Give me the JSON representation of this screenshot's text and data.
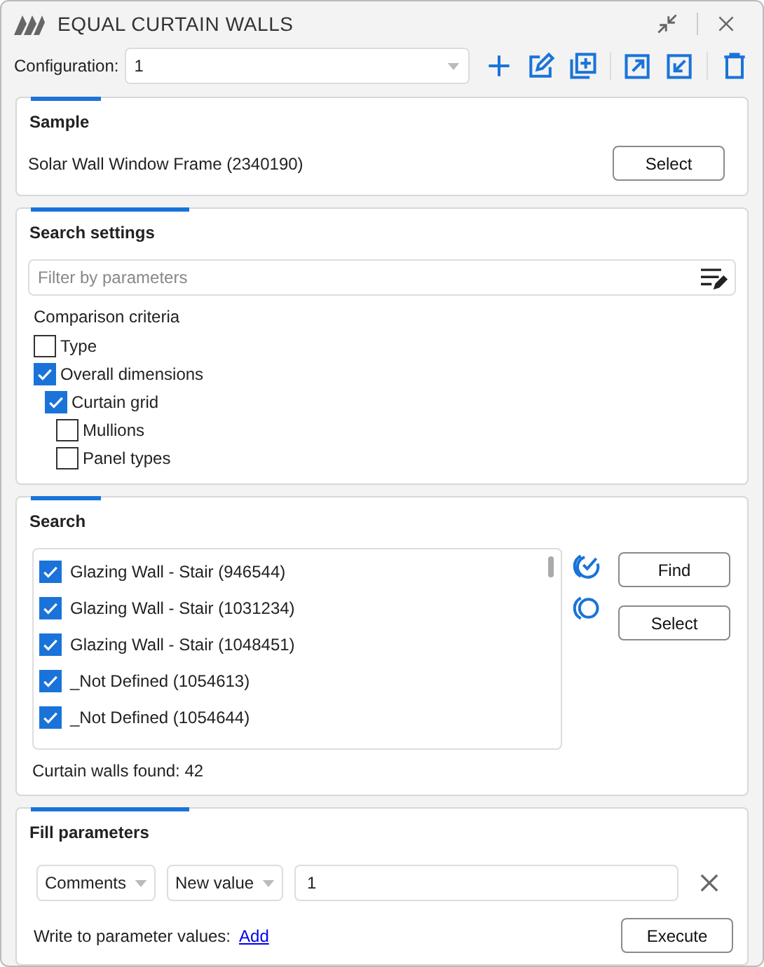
{
  "window": {
    "title": "EQUAL CURTAIN WALLS"
  },
  "configuration": {
    "label": "Configuration:",
    "value": "1"
  },
  "sample": {
    "title": "Sample",
    "element": "Solar Wall Window Frame (2340190)",
    "button": "Select"
  },
  "search_settings": {
    "title": "Search settings",
    "filter": {
      "placeholder": "Filter by parameters"
    },
    "criteria_label": "Comparison criteria",
    "criteria": [
      {
        "label": "Type",
        "checked": false
      },
      {
        "label": "Overall dimensions",
        "checked": true,
        "children": [
          {
            "label": "Curtain grid",
            "checked": true,
            "children": [
              {
                "label": "Mullions",
                "checked": false
              },
              {
                "label": "Panel types",
                "checked": false
              }
            ]
          }
        ]
      }
    ]
  },
  "search": {
    "title": "Search",
    "results": [
      {
        "label": "Glazing Wall - Stair (946544)",
        "checked": true
      },
      {
        "label": "Glazing Wall - Stair (1031234)",
        "checked": true
      },
      {
        "label": "Glazing Wall - Stair (1048451)",
        "checked": true
      },
      {
        "label": "_Not Defined (1054613)",
        "checked": true
      },
      {
        "label": "_Not Defined (1054644)",
        "checked": true
      }
    ],
    "buttons": [
      "Find",
      "Select"
    ],
    "found": "Curtain walls found: 42"
  },
  "fill_parameters": {
    "title": "Fill parameters",
    "parameter": "Comments",
    "mode": "New value",
    "value": "1",
    "write_label": "Write to parameter values:",
    "add_link": "Add",
    "button": "Execute"
  }
}
